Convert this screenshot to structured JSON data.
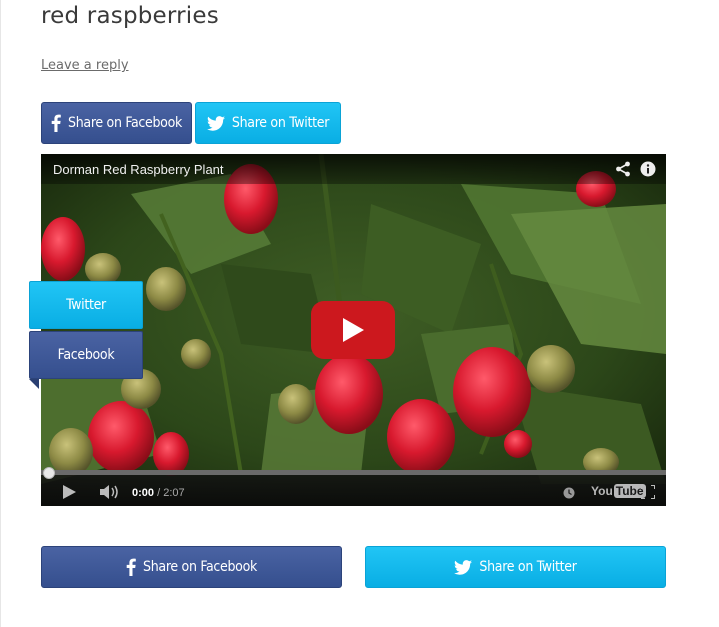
{
  "post": {
    "title": "red raspberries",
    "reply_link": "Leave a reply"
  },
  "share_top": {
    "facebook_label": "Share on Facebook",
    "twitter_label": "Share on Twitter"
  },
  "video": {
    "title": "Dorman Red Raspberry Plant",
    "current_time": "0:00",
    "duration": "/ 2:07",
    "progress": 0,
    "logo_you": "You",
    "logo_tube": "Tube"
  },
  "floating_share": {
    "twitter_label": "Twitter",
    "facebook_label": "Facebook"
  },
  "share_bottom": {
    "facebook_label": "Share on Facebook",
    "twitter_label": "Share on Twitter"
  },
  "colors": {
    "facebook": "#3b5998",
    "twitter": "#10b6ec",
    "youtube_red": "#cc181e"
  },
  "icons": [
    "facebook-icon",
    "twitter-icon",
    "share-icon",
    "info-icon",
    "play-icon",
    "volume-icon",
    "watch-later-icon",
    "fullscreen-icon"
  ]
}
